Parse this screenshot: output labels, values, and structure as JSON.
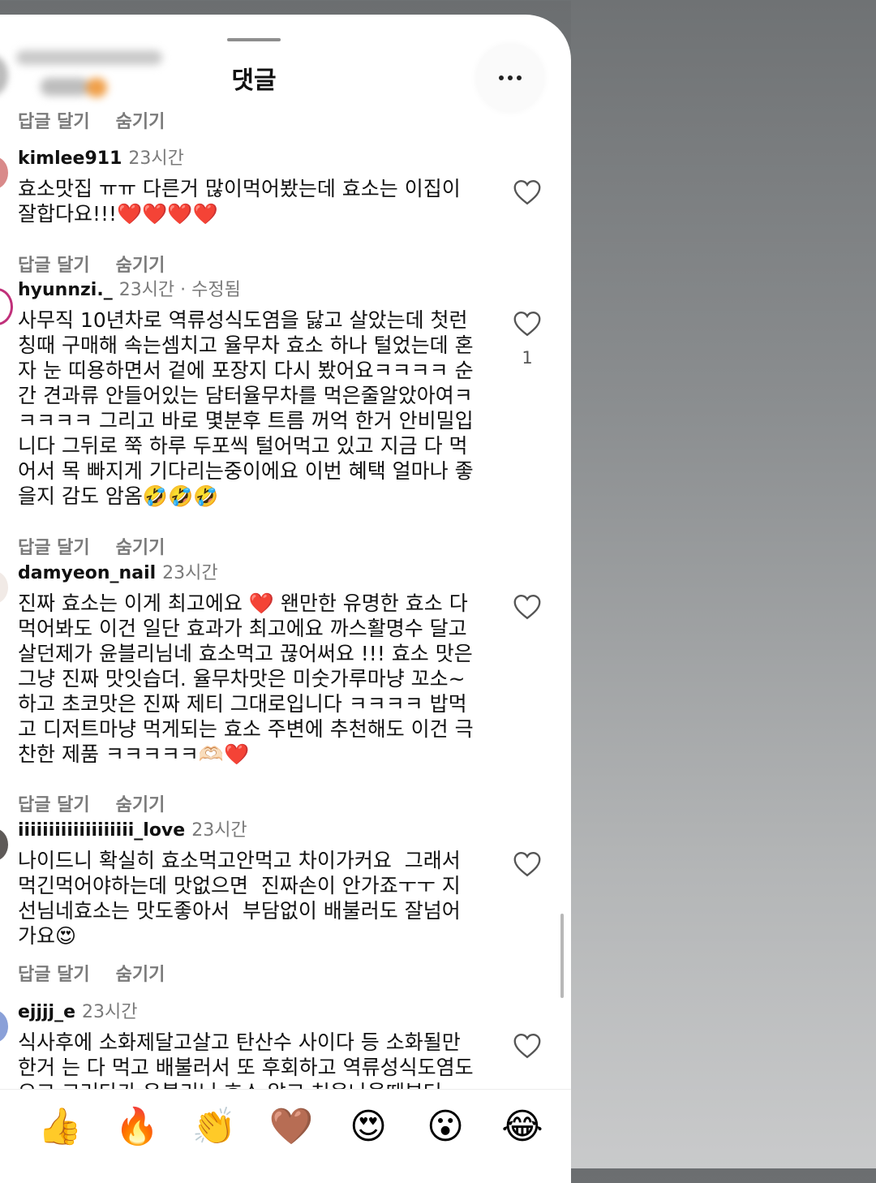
{
  "sheet": {
    "title": "댓글"
  },
  "top_actions": {
    "reply": "답글 달기",
    "hide": "숨기기"
  },
  "comments": [
    {
      "username": "kimlee911",
      "time": "23시간",
      "text": "효소맛집 ㅠㅠ 다른거 많이먹어봤는데 효소는 이집이\n잘합다요!!!❤️❤️❤️❤️",
      "reply": "답글 달기",
      "hide": "숨기기",
      "likes": ""
    },
    {
      "username": "hyunnzi._",
      "time": "23시간 · 수정됨",
      "text": "사무직 10년차로 역류성식도염을 닳고 살았는데 첫런\n칭때 구매해 속는셈치고 율무차 효소 하나 털었는데 혼\n자 눈 띠용하면서 겉에 포장지 다시 봤어요ㅋㅋㅋㅋ 순\n간 견과류 안들어있는 담터율무차를 먹은줄알았아여ㅋ\nㅋㅋㅋㅋ 그리고 바로 몇분후 트름 꺼억 한거 안비밀입\n니다 그뒤로 쭉 하루 두포씩 털어먹고 있고 지금 다 먹\n어서 목 빠지게 기다리는중이에요 이번 혜택 얼마나 좋\n을지 감도 암옴🤣🤣🤣",
      "reply": "답글 달기",
      "hide": "숨기기",
      "likes": "1"
    },
    {
      "username": "damyeon_nail",
      "time": "23시간",
      "text": "진짜 효소는 이게 최고에요 ❤️ 왠만한 유명한 효소 다\n먹어봐도 이건 일단 효과가 최고에요 까스활명수 달고\n살던제가 윤블리님네 효소먹고 끊어써요 !!! 효소 맛은\n그냥 진짜 맛잇습더. 율무차맛은 미숫가루마냥 꼬소~\n하고 초코맛은 진짜 제티 그대로입니다 ㅋㅋㅋㅋ 밥먹\n고 디저트마냥 먹게되는 효소 주변에 추천해도 이건 극\n찬한 제품 ㅋㅋㅋㅋㅋ🫶🏻❤️",
      "reply": "답글 달기",
      "hide": "숨기기",
      "likes": ""
    },
    {
      "username": "iiiiiiiiiiiiiiiiiii_love",
      "time": "23시간",
      "text": "나이드니 확실히 효소먹고안먹고 차이가커요  그래서\n먹긴먹어야하는데 맛없으면  진짜손이 안가죠ㅜㅜ 지\n선님네효소는 맛도좋아서  부담없이 배불러도 잘넘어\n가요😍",
      "reply": "답글 달기",
      "hide": "숨기기",
      "likes": ""
    },
    {
      "username": "ejjjj_e",
      "time": "23시간",
      "text": "식사후에 소화제달고살고 탄산수 사이다 등 소화될만\n한거 는 다 먹고 배불러서 또 후회하고 역류성식도염도\n오고 그러다가 윤블리님 효소 알고 처음나올때부터",
      "reply": "",
      "hide": "",
      "likes": ""
    }
  ],
  "reactions": [
    "👍",
    "🔥",
    "👏",
    "🤎",
    "😍",
    "😮",
    "😂"
  ],
  "icons": {
    "more": "more-horizontal-icon",
    "like": "heart-outline-icon"
  }
}
